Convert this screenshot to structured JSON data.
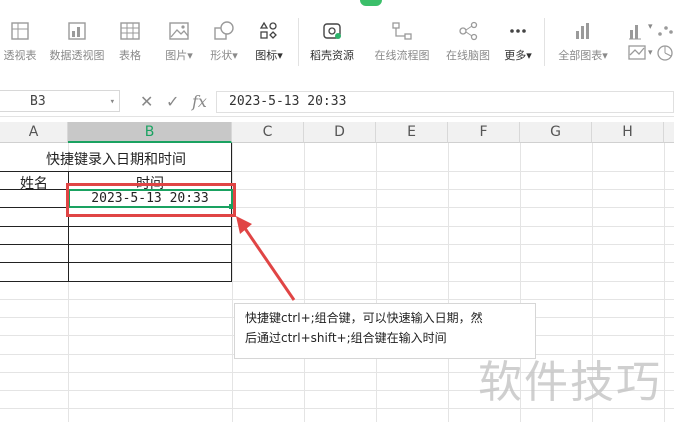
{
  "toolbar": {
    "items": [
      {
        "label": "透视表"
      },
      {
        "label": "数据透视图"
      },
      {
        "label": "表格"
      },
      {
        "label": "图片"
      },
      {
        "label": "形状"
      },
      {
        "label": "图标"
      },
      {
        "label": "稻壳资源"
      },
      {
        "label": "在线流程图"
      },
      {
        "label": "在线脑图"
      },
      {
        "label": "更多"
      },
      {
        "label": "全部图表"
      }
    ]
  },
  "formula_bar": {
    "cell_ref": "B3",
    "fx": "fx",
    "value": "2023-5-13  20:33"
  },
  "columns": [
    "A",
    "B",
    "C",
    "D",
    "E",
    "F",
    "G",
    "H"
  ],
  "sheet": {
    "title": "快捷键录入日期和时间",
    "header_name": "姓名",
    "header_time": "时间",
    "b3_value": "2023-5-13  20:33"
  },
  "callout": {
    "line1": "快捷键ctrl+;组合键，可以快速输入日期，然",
    "line2": "后通过ctrl+shift+;组合键在输入时间"
  },
  "watermark": "软件技巧",
  "colors": {
    "accent": "#1aa261",
    "highlight": "#e04545"
  }
}
